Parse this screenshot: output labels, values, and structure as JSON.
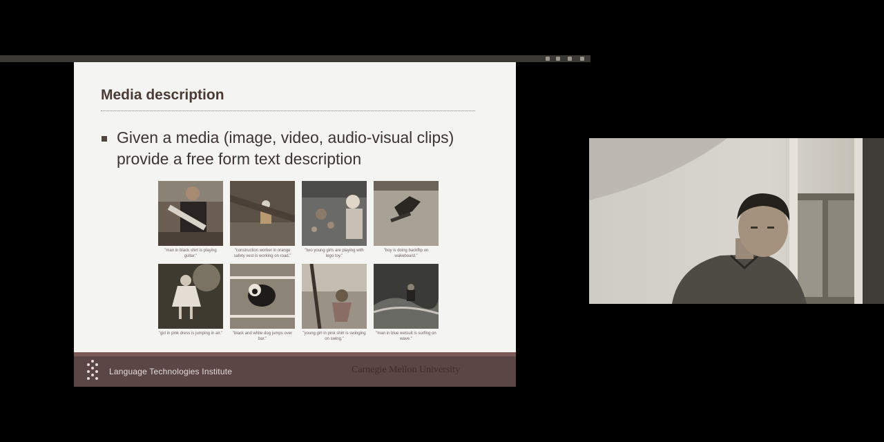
{
  "slide": {
    "title": "Media description",
    "bullet": "Given a media (image, video, audio-visual clips) provide a free form text description",
    "images": [
      {
        "caption": "\"man in black shirt is playing guitar.\"",
        "icon": "guitar-photo"
      },
      {
        "caption": "\"construction worker in orange safety vest is working on road.\"",
        "icon": "construction-photo"
      },
      {
        "caption": "\"two young girls are playing with lego toy.\"",
        "icon": "lego-photo"
      },
      {
        "caption": "\"boy is doing backflip on wakeboard.\"",
        "icon": "wakeboard-photo"
      },
      {
        "caption": "\"girl in pink dress is jumping in air.\"",
        "icon": "girl-jumping-photo"
      },
      {
        "caption": "\"black and white dog jumps over bar.\"",
        "icon": "dog-jumping-photo"
      },
      {
        "caption": "\"young girl in pink shirt is swinging on swing.\"",
        "icon": "swing-photo"
      },
      {
        "caption": "\"man in blue wetsuit is surfing on wave.\"",
        "icon": "surfing-photo"
      }
    ]
  },
  "footer": {
    "institute": "Language Technologies Institute",
    "university": "Carnegie Mellon University"
  },
  "webcam": {
    "icon": "presenter-video-feed"
  }
}
